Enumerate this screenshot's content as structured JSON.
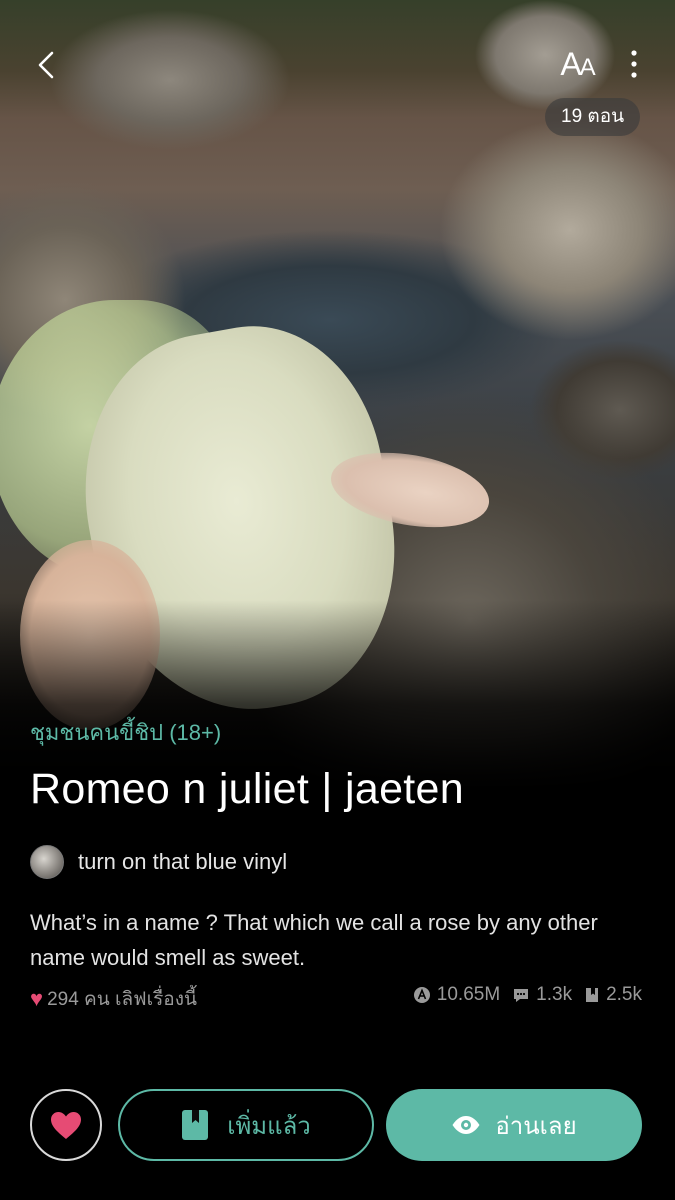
{
  "header": {
    "episodes_badge": "19 ตอน"
  },
  "story": {
    "category": "ชุมชนคนขี้ชิป (18+)",
    "title": "Romeo n juliet | jaeten",
    "author": "turn on that blue vinyl",
    "description": "What’s in a name ?   That which we call a rose by any other name would smell as sweet."
  },
  "stats": {
    "likes_label": "294 คน เลิฟเรื่องนี้",
    "views": "10.65M",
    "comments": "1.3k",
    "bookmarks": "2.5k"
  },
  "actions": {
    "library_label": "เพิ่มแล้ว",
    "read_label": "อ่านเลย"
  },
  "colors": {
    "accent": "#5db9a6",
    "heart": "#e64b74",
    "background": "#000000"
  }
}
